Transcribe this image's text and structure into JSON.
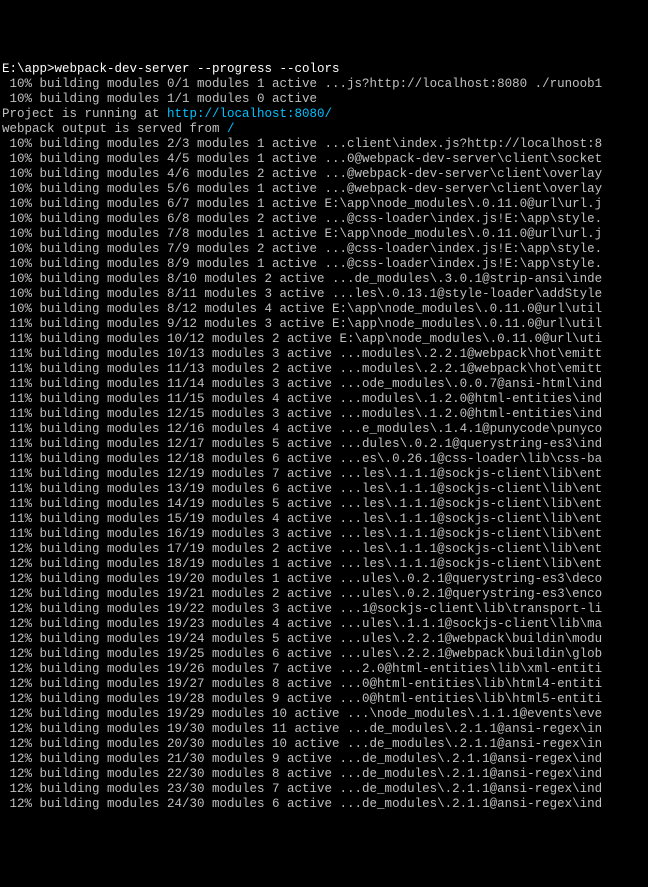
{
  "prompt": {
    "path": "E:\\app>",
    "command": "webpack-dev-server --progress --colors"
  },
  "intro_lines": [
    {
      "text": " 10% building modules 0/1 modules 1 active ...js?http://localhost:8080 ./runoob1"
    },
    {
      "text": " 10% building modules 1/1 modules 0 active"
    }
  ],
  "project_line": {
    "prefix": "Project is running at ",
    "url": "http://localhost:8080/"
  },
  "served_line": {
    "prefix": "webpack output is served from ",
    "path": "/"
  },
  "build_lines": [
    " 10% building modules 2/3 modules 1 active ...client\\index.js?http://localhost:8",
    " 10% building modules 4/5 modules 1 active ...0@webpack-dev-server\\client\\socket",
    " 10% building modules 4/6 modules 2 active ...@webpack-dev-server\\client\\overlay",
    " 10% building modules 5/6 modules 1 active ...@webpack-dev-server\\client\\overlay",
    " 10% building modules 6/7 modules 1 active E:\\app\\node_modules\\.0.11.0@url\\url.j",
    " 10% building modules 6/8 modules 2 active ...@css-loader\\index.js!E:\\app\\style.",
    " 10% building modules 7/8 modules 1 active E:\\app\\node_modules\\.0.11.0@url\\url.j",
    " 10% building modules 7/9 modules 2 active ...@css-loader\\index.js!E:\\app\\style.",
    " 10% building modules 8/9 modules 1 active ...@css-loader\\index.js!E:\\app\\style.",
    " 10% building modules 8/10 modules 2 active ...de_modules\\.3.0.1@strip-ansi\\inde",
    " 10% building modules 8/11 modules 3 active ...les\\.0.13.1@style-loader\\addStyle",
    " 10% building modules 8/12 modules 4 active E:\\app\\node_modules\\.0.11.0@url\\util",
    " 11% building modules 9/12 modules 3 active E:\\app\\node_modules\\.0.11.0@url\\util",
    " 11% building modules 10/12 modules 2 active E:\\app\\node_modules\\.0.11.0@url\\uti",
    " 11% building modules 10/13 modules 3 active ...modules\\.2.2.1@webpack\\hot\\emitt",
    " 11% building modules 11/13 modules 2 active ...modules\\.2.2.1@webpack\\hot\\emitt",
    " 11% building modules 11/14 modules 3 active ...ode_modules\\.0.0.7@ansi-html\\ind",
    " 11% building modules 11/15 modules 4 active ...modules\\.1.2.0@html-entities\\ind",
    " 11% building modules 12/15 modules 3 active ...modules\\.1.2.0@html-entities\\ind",
    " 11% building modules 12/16 modules 4 active ...e_modules\\.1.4.1@punycode\\punyco",
    " 11% building modules 12/17 modules 5 active ...dules\\.0.2.1@querystring-es3\\ind",
    " 11% building modules 12/18 modules 6 active ...es\\.0.26.1@css-loader\\lib\\css-ba",
    " 11% building modules 12/19 modules 7 active ...les\\.1.1.1@sockjs-client\\lib\\ent",
    " 11% building modules 13/19 modules 6 active ...les\\.1.1.1@sockjs-client\\lib\\ent",
    " 11% building modules 14/19 modules 5 active ...les\\.1.1.1@sockjs-client\\lib\\ent",
    " 11% building modules 15/19 modules 4 active ...les\\.1.1.1@sockjs-client\\lib\\ent",
    " 11% building modules 16/19 modules 3 active ...les\\.1.1.1@sockjs-client\\lib\\ent",
    " 12% building modules 17/19 modules 2 active ...les\\.1.1.1@sockjs-client\\lib\\ent",
    " 12% building modules 18/19 modules 1 active ...les\\.1.1.1@sockjs-client\\lib\\ent",
    " 12% building modules 19/20 modules 1 active ...ules\\.0.2.1@querystring-es3\\deco",
    " 12% building modules 19/21 modules 2 active ...ules\\.0.2.1@querystring-es3\\enco",
    " 12% building modules 19/22 modules 3 active ...1@sockjs-client\\lib\\transport-li",
    " 12% building modules 19/23 modules 4 active ...ules\\.1.1.1@sockjs-client\\lib\\ma",
    " 12% building modules 19/24 modules 5 active ...ules\\.2.2.1@webpack\\buildin\\modu",
    " 12% building modules 19/25 modules 6 active ...ules\\.2.2.1@webpack\\buildin\\glob",
    " 12% building modules 19/26 modules 7 active ...2.0@html-entities\\lib\\xml-entiti",
    " 12% building modules 19/27 modules 8 active ...0@html-entities\\lib\\html4-entiti",
    " 12% building modules 19/28 modules 9 active ...0@html-entities\\lib\\html5-entiti",
    " 12% building modules 19/29 modules 10 active ...\\node_modules\\.1.1.1@events\\eve",
    " 12% building modules 19/30 modules 11 active ...de_modules\\.2.1.1@ansi-regex\\in",
    " 12% building modules 20/30 modules 10 active ...de_modules\\.2.1.1@ansi-regex\\in",
    " 12% building modules 21/30 modules 9 active ...de_modules\\.2.1.1@ansi-regex\\ind",
    " 12% building modules 22/30 modules 8 active ...de_modules\\.2.1.1@ansi-regex\\ind",
    " 12% building modules 23/30 modules 7 active ...de_modules\\.2.1.1@ansi-regex\\ind",
    " 12% building modules 24/30 modules 6 active ...de_modules\\.2.1.1@ansi-regex\\ind"
  ]
}
